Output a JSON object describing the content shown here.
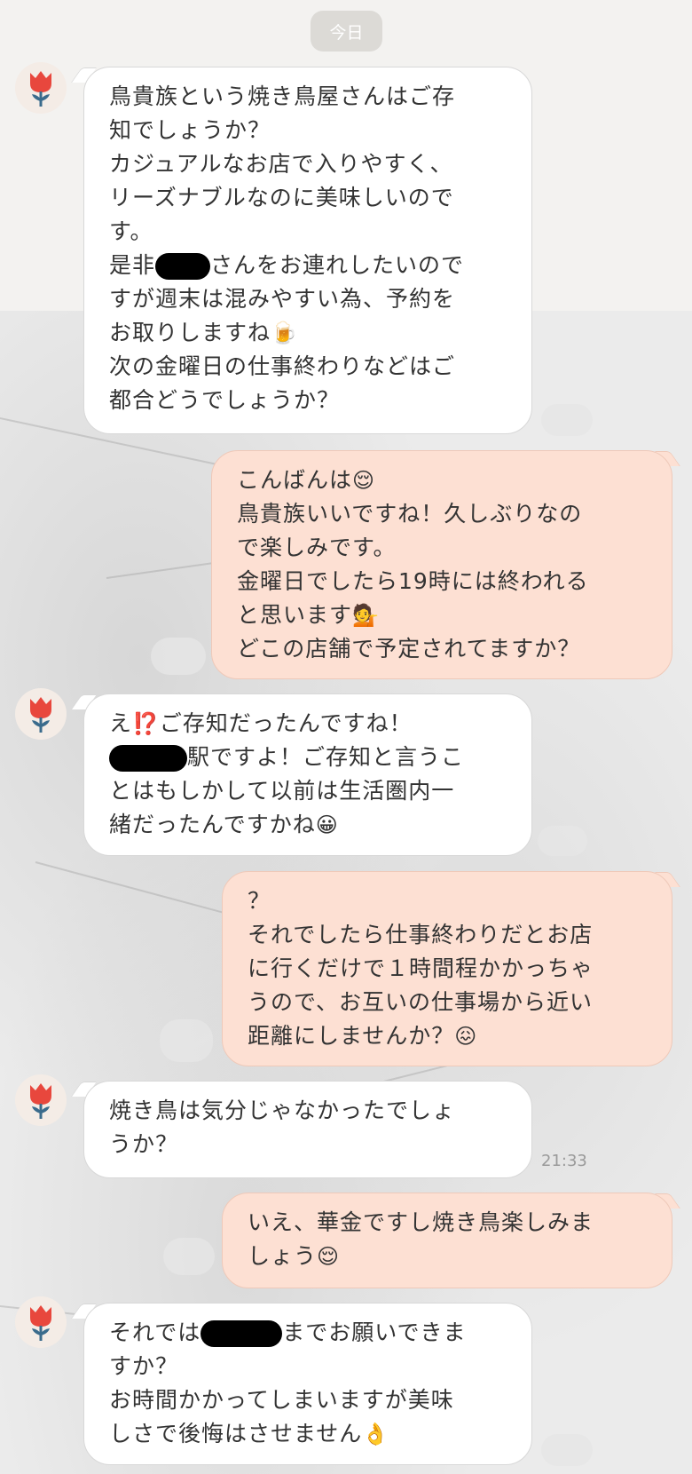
{
  "date_label": "今日",
  "messages": [
    {
      "side": "in",
      "lines": [
        "鳥貴族という焼き鳥屋さんはご存",
        "知でしょうか？",
        "カジュアルなお店で入りやすく、",
        "リーズナブルなのに美味しいので",
        "す。",
        "是非",
        "さんをお連れしたいので",
        "すが週末は混みやすい為、予約を",
        "お取りしますね",
        "次の金曜日の仕事終わりなどはご",
        "都合どうでしょうか？"
      ]
    },
    {
      "side": "out",
      "lines": [
        "こんばんは",
        "鳥貴族いいですね！久しぶりなの",
        "で楽しみです。",
        "金曜日でしたら19時には終われる",
        "と思います",
        "どこの店舗で予定されてますか？"
      ]
    },
    {
      "side": "in",
      "lines": [
        "え",
        "ご存知だったんですね！",
        "駅ですよ！ご存知と言うこ",
        "とはもしかして以前は生活圏内一",
        "緒だったんですかね"
      ]
    },
    {
      "side": "out",
      "lines": [
        "？",
        "それでしたら仕事終わりだとお店",
        "に行くだけで１時間程かかっちゃ",
        "うので、お互いの仕事場から近い",
        "距離にしませんか？"
      ]
    },
    {
      "side": "in",
      "lines": [
        "焼き鳥は気分じゃなかったでしょ",
        "うか？"
      ],
      "time": "21:33"
    },
    {
      "side": "out",
      "lines": [
        "いえ、華金ですし焼き鳥楽しみま",
        "しょう"
      ]
    },
    {
      "side": "in",
      "lines": [
        "それでは",
        "までお願いできま",
        "すか？",
        "お時間かかってしまいますが美味",
        "しさで後悔はさせません"
      ]
    }
  ],
  "emoji": {
    "beer": "🍺",
    "relieved": "😌",
    "woman_raising_hand": "💁",
    "exclamation_question": "⁉️",
    "grinning": "😀",
    "confounded": "😖",
    "ok_hand": "👌"
  },
  "avatar_icon": "tulip-icon",
  "colors": {
    "incoming_bubble": "#ffffff",
    "outgoing_bubble": "#fde0d3",
    "text": "#333333",
    "date_pill": "#dcdad6"
  }
}
